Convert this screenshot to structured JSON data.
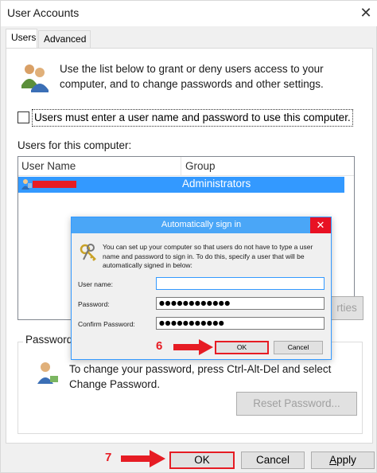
{
  "window": {
    "title": "User Accounts",
    "close_glyph": "✕"
  },
  "tabs": [
    {
      "label": "Users",
      "active": true
    },
    {
      "label": "Advanced",
      "active": false
    }
  ],
  "intro": {
    "icon": "users-icon",
    "text": "Use the list below to grant or deny users access to your computer, and to change passwords and other settings."
  },
  "require_login": {
    "checked": false,
    "label": "Users must enter a user name and password to use this computer."
  },
  "users_section": {
    "label": "Users for this computer:",
    "columns": [
      "User Name",
      "Group"
    ],
    "rows": [
      {
        "user_name": "",
        "group": "Administrators",
        "selected": true,
        "redacted": true
      }
    ]
  },
  "properties_button": {
    "label": "rties"
  },
  "password_section": {
    "legend": "Password f",
    "text": "To change your password, press Ctrl-Alt-Del and select Change Password.",
    "reset_button": "Reset Password..."
  },
  "bottom_buttons": {
    "ok": "OK",
    "cancel": "Cancel",
    "apply_prefix": "",
    "apply_underlined": "A",
    "apply_rest": "pply"
  },
  "dialog": {
    "title": "Automatically sign in",
    "close_glyph": "✕",
    "description": "You can set up your computer so that users do not have to type a user name and password to sign in. To do this, specify a user that will be automatically signed in below:",
    "user_name_label": "User name:",
    "user_name_value": "",
    "password_label": "Password:",
    "password_value": "●●●●●●●●●●●●",
    "confirm_label": "Confirm Password:",
    "confirm_value": "●●●●●●●●●●●",
    "ok_label": "OK",
    "cancel_label": "Cancel"
  },
  "annotations": {
    "step6": "6",
    "step7": "7",
    "arrow_color": "#e61c24",
    "highlight_color": "#e61c24"
  },
  "colors": {
    "selection": "#3399ff",
    "dialog_title": "#4aa6f7",
    "close_red": "#e81123"
  }
}
